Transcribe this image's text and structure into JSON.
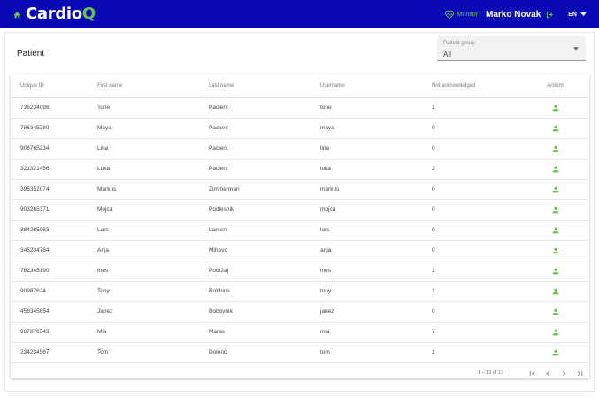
{
  "header": {
    "brand_main": "Cardio",
    "brand_accent": "Q",
    "monitor_label": "Monitor",
    "user_name": "Marko Novak",
    "language": "EN"
  },
  "page": {
    "title": "Patient",
    "filter": {
      "label": "Patient group",
      "value": "All"
    }
  },
  "table": {
    "columns": [
      "Unique ID",
      "First name",
      "Last name",
      "Username",
      "Not acknowledged",
      "Actions"
    ],
    "rows": [
      [
        "736234098",
        "Tone",
        "Pacient",
        "tone",
        "1"
      ],
      [
        "786345280",
        "Maya",
        "Pacient",
        "maya",
        "0"
      ],
      [
        "908765234",
        "Lina",
        "Pacient",
        "lina",
        "0"
      ],
      [
        "321321456",
        "Luka",
        "Pacient",
        "luka",
        "2"
      ],
      [
        "396352074",
        "Markus",
        "Zimmerman",
        "markus",
        "0"
      ],
      [
        "903265371",
        "Mojca",
        "Podlesnik",
        "mojca",
        "0"
      ],
      [
        "384285063",
        "Lars",
        "Larsen",
        "lars",
        "0"
      ],
      [
        "345234784",
        "Anja",
        "Mihevc",
        "anja",
        "0"
      ],
      [
        "762345190",
        "Ines",
        "Podržaj",
        "ines",
        "1"
      ],
      [
        "90987624",
        "Tony",
        "Robbins",
        "tony",
        "1"
      ],
      [
        "456345654",
        "Janez",
        "Bobovnik",
        "janez",
        "0"
      ],
      [
        "987876543",
        "Mia",
        "Maras",
        "mia",
        "7"
      ],
      [
        "234234567",
        "Tom",
        "Dolenc",
        "tom",
        "1"
      ]
    ]
  },
  "paginator": {
    "range": "1 – 13 of 13"
  },
  "icons": {
    "home": "home-icon",
    "monitor": "heart-monitor-icon",
    "logout": "logout-icon",
    "dropdown": "chevron-down-icon",
    "action": "person-icon",
    "first_page": "first-page-icon",
    "prev_page": "chevron-left-icon",
    "next_page": "chevron-right-icon",
    "last_page": "last-page-icon"
  },
  "colors": {
    "header_bg": "#0a0ab4",
    "accent_green": "#6cc24a"
  }
}
